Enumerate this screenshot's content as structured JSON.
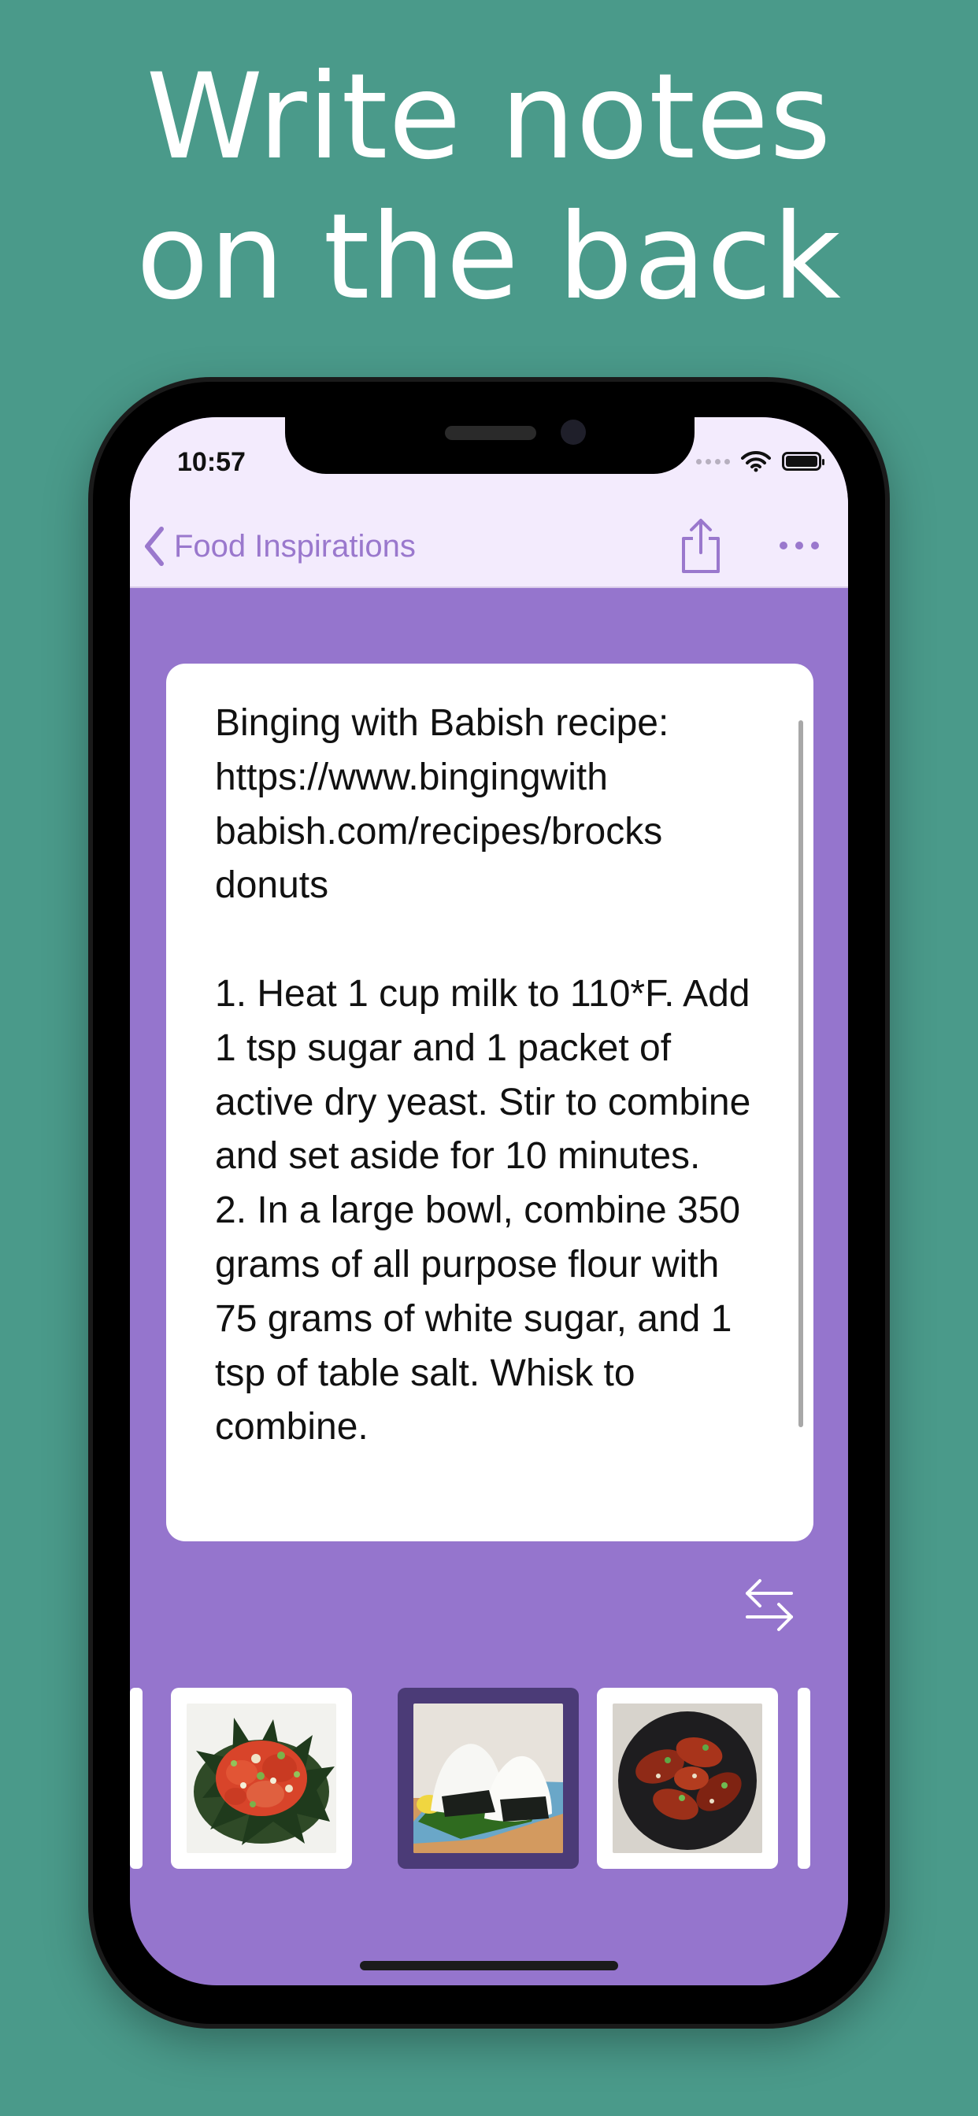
{
  "promo": {
    "headline_line1": "Write notes",
    "headline_line2": "on the back"
  },
  "status_bar": {
    "time": "10:57",
    "icons": [
      "cellular-signal-icon",
      "wifi-icon",
      "battery-icon"
    ]
  },
  "nav": {
    "back_label": "Food Inspirations",
    "back_icon": "chevron-left-icon",
    "share_icon": "share-icon",
    "more_icon": "more-icon"
  },
  "note": {
    "text": "Binging with Babish recipe: https://www.bingingwith babish.com/recipes/brocks donuts\n\n1. Heat 1 cup milk to 110*F. Add 1 tsp sugar and 1 packet of active dry yeast. Stir to combine and set aside for 10 minutes.\n2. In a large bowl, combine 350 grams of all purpose flour with 75 grams of white sugar, and 1 tsp of table salt. Whisk to combine."
  },
  "flip_control": {
    "icon": "swap-arrows-icon"
  },
  "thumbnails": [
    {
      "name": "poke-bowl",
      "selected": false
    },
    {
      "name": "onigiri",
      "selected": true
    },
    {
      "name": "glazed-wings",
      "selected": false
    }
  ],
  "colors": {
    "background": "#4a9a8a",
    "screen": "#9575cd",
    "nav_bar": "#f3ebfd",
    "accent": "#9a78cd",
    "selected_frame": "#4b3b77"
  }
}
